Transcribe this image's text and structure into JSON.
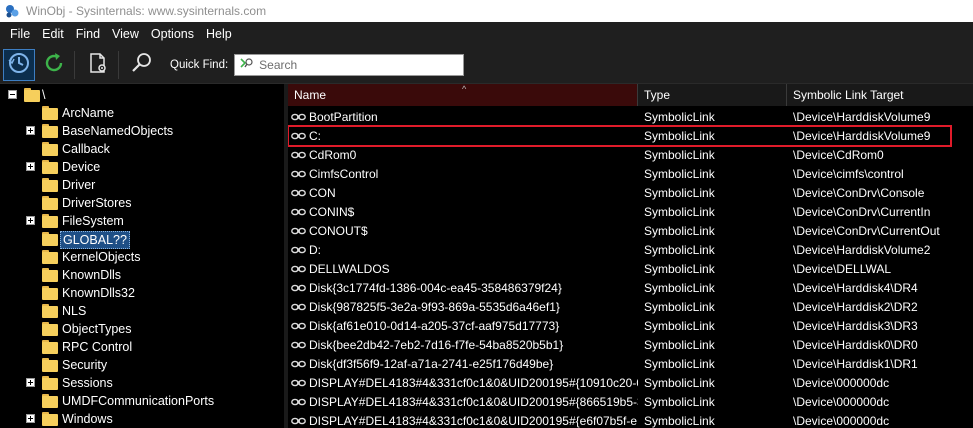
{
  "window": {
    "title": "WinObj - Sysinternals: www.sysinternals.com"
  },
  "menu": [
    "File",
    "Edit",
    "Find",
    "View",
    "Options",
    "Help"
  ],
  "toolbar": {
    "quick_find_label": "Quick Find:",
    "search_placeholder": "Search",
    "buttons": [
      "history-icon",
      "refresh-icon",
      "properties-icon",
      "find-icon"
    ]
  },
  "tree": {
    "root": "\\",
    "items": [
      {
        "label": "ArcName",
        "expandable": false
      },
      {
        "label": "BaseNamedObjects",
        "expandable": true
      },
      {
        "label": "Callback",
        "expandable": false
      },
      {
        "label": "Device",
        "expandable": true
      },
      {
        "label": "Driver",
        "expandable": false
      },
      {
        "label": "DriverStores",
        "expandable": false
      },
      {
        "label": "FileSystem",
        "expandable": true
      },
      {
        "label": "GLOBAL??",
        "expandable": false,
        "selected": true
      },
      {
        "label": "KernelObjects",
        "expandable": false
      },
      {
        "label": "KnownDlls",
        "expandable": false
      },
      {
        "label": "KnownDlls32",
        "expandable": false
      },
      {
        "label": "NLS",
        "expandable": false
      },
      {
        "label": "ObjectTypes",
        "expandable": false
      },
      {
        "label": "RPC Control",
        "expandable": false
      },
      {
        "label": "Security",
        "expandable": false
      },
      {
        "label": "Sessions",
        "expandable": true
      },
      {
        "label": "UMDFCommunicationPorts",
        "expandable": false
      },
      {
        "label": "Windows",
        "expandable": true
      }
    ]
  },
  "list": {
    "columns": {
      "name": "Name",
      "type": "Type",
      "target": "Symbolic Link Target"
    },
    "sort_indicator": "^",
    "rows": [
      {
        "name": "BootPartition",
        "type": "SymbolicLink",
        "target": "\\Device\\HarddiskVolume9"
      },
      {
        "name": "C:",
        "type": "SymbolicLink",
        "target": "\\Device\\HarddiskVolume9",
        "highlighted": true
      },
      {
        "name": "CdRom0",
        "type": "SymbolicLink",
        "target": "\\Device\\CdRom0"
      },
      {
        "name": "CimfsControl",
        "type": "SymbolicLink",
        "target": "\\Device\\cimfs\\control"
      },
      {
        "name": "CON",
        "type": "SymbolicLink",
        "target": "\\Device\\ConDrv\\Console"
      },
      {
        "name": "CONIN$",
        "type": "SymbolicLink",
        "target": "\\Device\\ConDrv\\CurrentIn"
      },
      {
        "name": "CONOUT$",
        "type": "SymbolicLink",
        "target": "\\Device\\ConDrv\\CurrentOut"
      },
      {
        "name": "D:",
        "type": "SymbolicLink",
        "target": "\\Device\\HarddiskVolume2"
      },
      {
        "name": "DELLWALDOS",
        "type": "SymbolicLink",
        "target": "\\Device\\DELLWAL"
      },
      {
        "name": "Disk{3c1774fd-1386-004c-ea45-358486379f24}",
        "type": "SymbolicLink",
        "target": "\\Device\\Harddisk4\\DR4"
      },
      {
        "name": "Disk{987825f5-3e2a-9f93-869a-5535d6a46ef1}",
        "type": "SymbolicLink",
        "target": "\\Device\\Harddisk2\\DR2"
      },
      {
        "name": "Disk{af61e010-0d14-a205-37cf-aaf975d17773}",
        "type": "SymbolicLink",
        "target": "\\Device\\Harddisk3\\DR3"
      },
      {
        "name": "Disk{bee2db42-7eb2-7d16-f7fe-54ba8520b5b1}",
        "type": "SymbolicLink",
        "target": "\\Device\\Harddisk0\\DR0"
      },
      {
        "name": "Disk{df3f56f9-12af-a71a-2741-e25f176d49be}",
        "type": "SymbolicLink",
        "target": "\\Device\\Harddisk1\\DR1"
      },
      {
        "name": "DISPLAY#DEL4183#4&331cf0c1&0&UID200195#{10910c20-0...",
        "type": "SymbolicLink",
        "target": "\\Device\\000000dc"
      },
      {
        "name": "DISPLAY#DEL4183#4&331cf0c1&0&UID200195#{866519b5-3...",
        "type": "SymbolicLink",
        "target": "\\Device\\000000dc"
      },
      {
        "name": "DISPLAY#DEL4183#4&331cf0c1&0&UID200195#{e6f07b5f-e...",
        "type": "SymbolicLink",
        "target": "\\Device\\000000dc"
      }
    ]
  },
  "colors": {
    "highlight_border": "#e01b2a",
    "selected_tree_bg": "#1e4f86",
    "sorted_header_bg": "#3a0a0a"
  }
}
